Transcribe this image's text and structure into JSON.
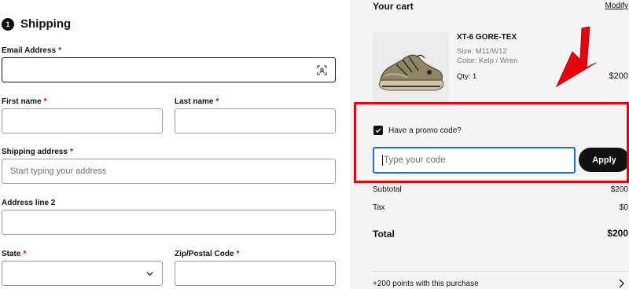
{
  "shipping": {
    "step_number": "1",
    "title": "Shipping",
    "fields": {
      "email": {
        "label": "Email Address",
        "required_mark": "*",
        "value": ""
      },
      "first_name": {
        "label": "First name",
        "required_mark": "*",
        "value": ""
      },
      "last_name": {
        "label": "Last name",
        "required_mark": "*",
        "value": ""
      },
      "shipping_address": {
        "label": "Shipping address",
        "required_mark": "*",
        "placeholder": "Start typing your address"
      },
      "address_line2": {
        "label": "Address line 2",
        "value": ""
      },
      "state": {
        "label": "State",
        "required_mark": "*",
        "value": ""
      },
      "zip": {
        "label": "Zip/Postal Code",
        "required_mark": "*",
        "value": ""
      }
    }
  },
  "cart": {
    "title": "Your cart",
    "modify_label": "Modify",
    "product": {
      "name": "XT-6 GORE-TEX",
      "size": "Size: M11/W12",
      "color": "Color: Kelp / Wren",
      "qty": "Qty: 1",
      "price": "$200",
      "image_icon": "sneaker-icon"
    },
    "promo": {
      "checkbox_label": "Have a promo code?",
      "checked": true,
      "input_placeholder": "Type your code",
      "apply_label": "Apply"
    },
    "summary": {
      "subtotal_label": "Subtotal",
      "subtotal_value": "$200",
      "tax_label": "Tax",
      "tax_value": "$0",
      "total_label": "Total",
      "total_value": "$200"
    },
    "points_text": "+200 points with this purchase"
  },
  "colors": {
    "accent_blue": "#1b6fd1",
    "annotation_red": "#e8000b",
    "required_red": "#d0021b"
  }
}
